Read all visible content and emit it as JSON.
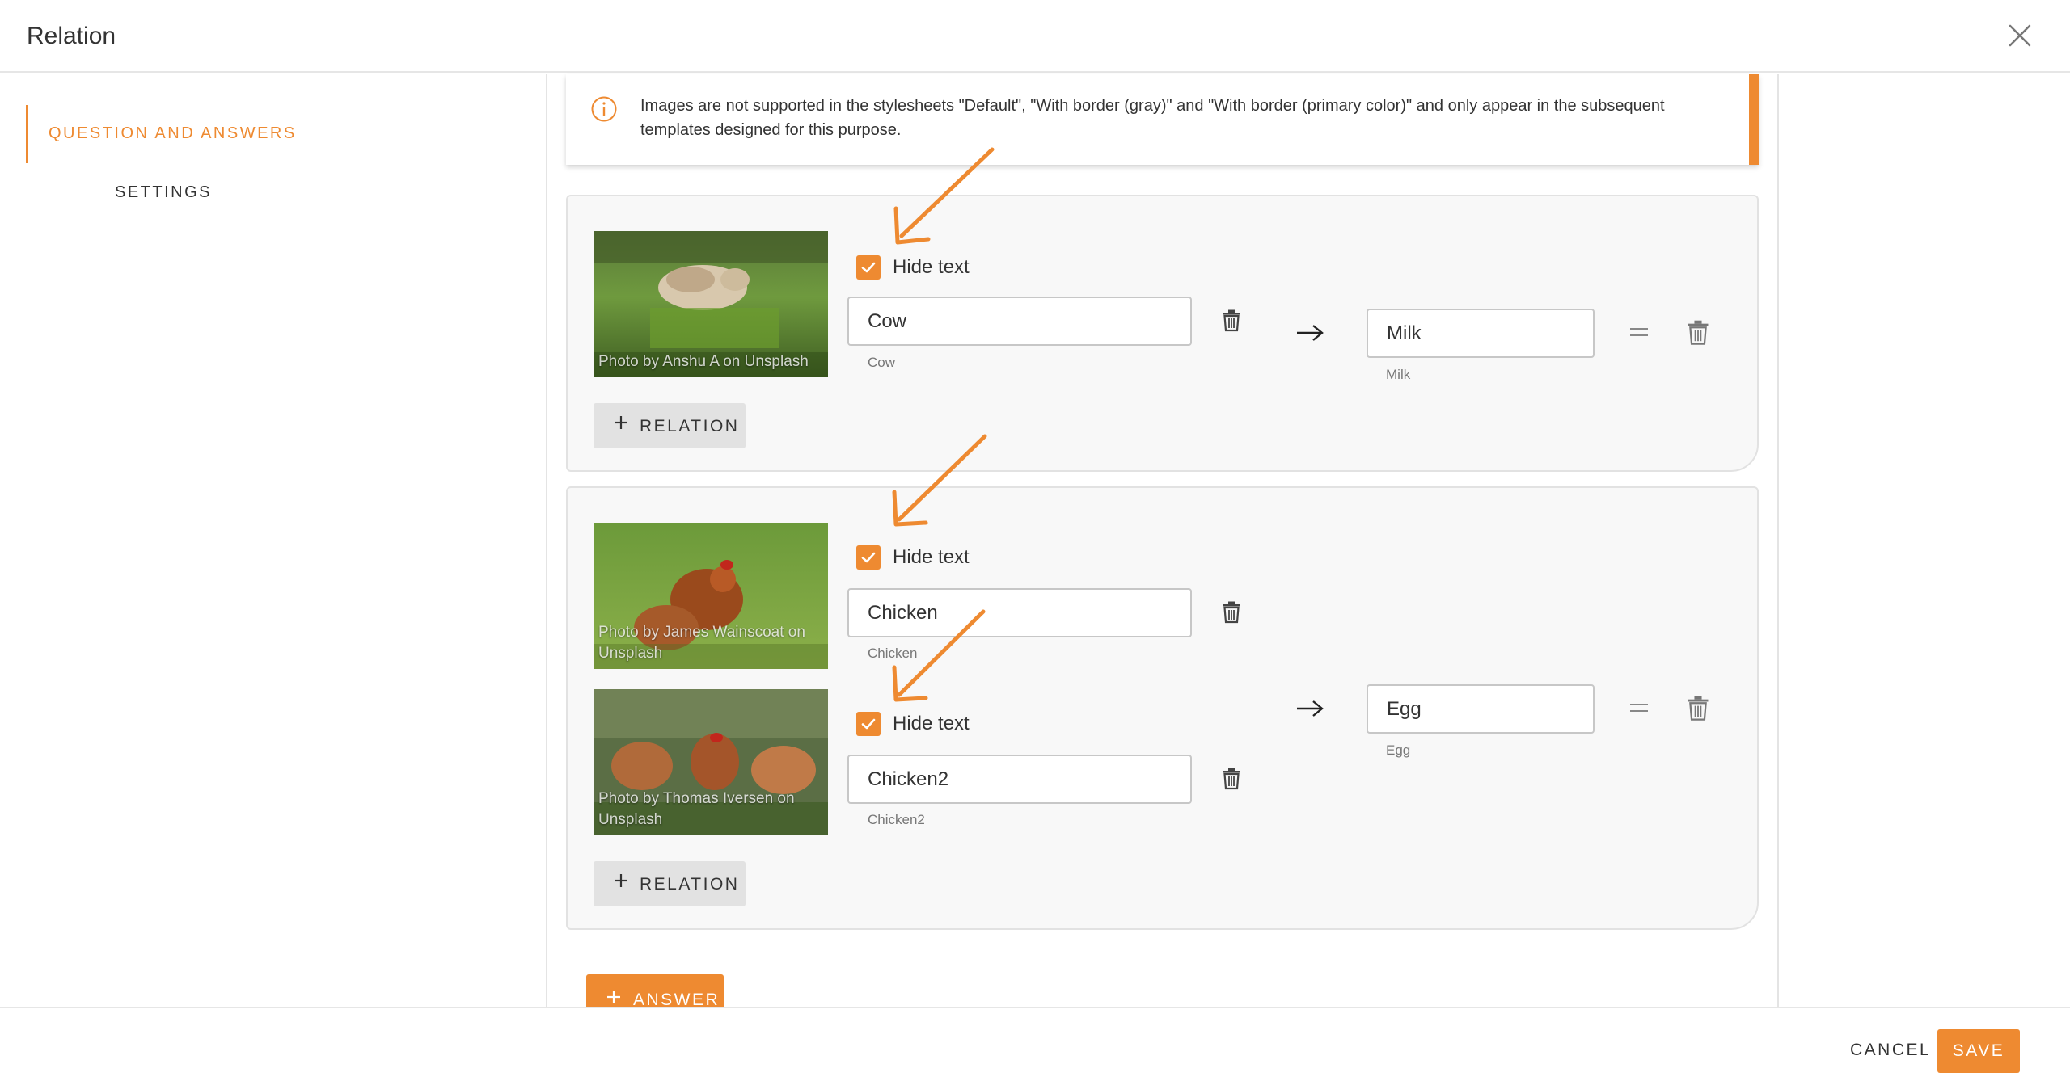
{
  "dialog": {
    "title": "Relation"
  },
  "sidebar": {
    "items": [
      {
        "label": "QUESTION AND ANSWERS",
        "active": true
      },
      {
        "label": "SETTINGS",
        "active": false
      }
    ]
  },
  "notice": {
    "icon": "info-icon",
    "text": "Images are not supported in the stylesheets \"Default\", \"With border (gray)\" and \"With border (primary color)\" and only appear in the subsequent templates designed for this purpose."
  },
  "relations": [
    {
      "questions": [
        {
          "image_credit": "Photo by Anshu A on Unsplash",
          "hide_text_label": "Hide text",
          "hide_text_checked": true,
          "value": "Cow",
          "caption": "Cow"
        }
      ],
      "answer": {
        "value": "Milk",
        "caption": "Milk"
      },
      "add_relation_label": "RELATION"
    },
    {
      "questions": [
        {
          "image_credit": "Photo by James Wainscoat on Unsplash",
          "hide_text_label": "Hide text",
          "hide_text_checked": true,
          "value": "Chicken",
          "caption": "Chicken"
        },
        {
          "image_credit": "Photo by Thomas Iversen on Unsplash",
          "hide_text_label": "Hide text",
          "hide_text_checked": true,
          "value": "Chicken2",
          "caption": "Chicken2"
        }
      ],
      "answer": {
        "value": "Egg",
        "caption": "Egg"
      },
      "add_relation_label": "RELATION"
    }
  ],
  "add_answer_label": "ANSWER",
  "footer": {
    "cancel_label": "CANCEL",
    "save_label": "SAVE"
  },
  "colors": {
    "accent": "#ee8a31",
    "card_bg": "#f8f8f8",
    "button_gray": "#e2e2e2"
  }
}
